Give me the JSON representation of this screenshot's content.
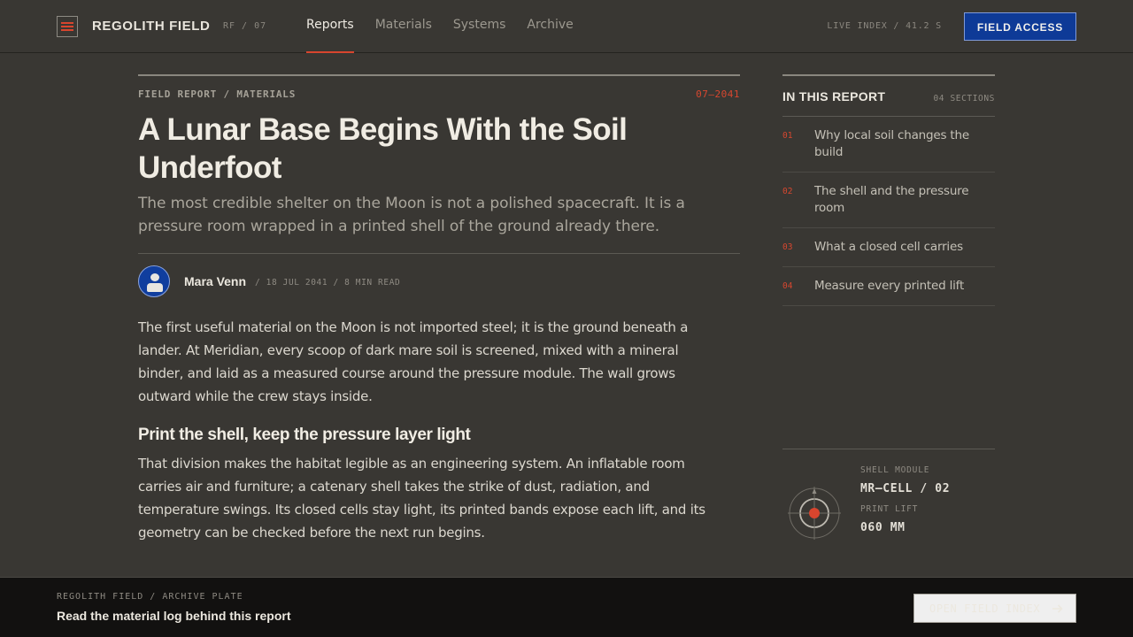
{
  "header": {
    "brand": "REGOLITH FIELD",
    "brand_code": "RF / 07",
    "nav": [
      {
        "label": "Reports",
        "active": true
      },
      {
        "label": "Materials"
      },
      {
        "label": "Systems"
      },
      {
        "label": "Archive"
      }
    ],
    "live_index": "LIVE INDEX / 41.2 S",
    "field_access_label": "FIELD ACCESS",
    "accent_color": "#d8452e",
    "cta_color": "#0e3a97"
  },
  "article": {
    "kicker": "FIELD REPORT / MATERIALS",
    "issue": "07—2041",
    "title": "A Lunar Base Begins With the Soil Underfoot",
    "dek": "The most credible shelter on the Moon is not a polished spacecraft. It is a pressure room wrapped in a printed shell of the ground already there.",
    "author": "Mara Venn",
    "meta": "/ 18 JUL 2041 / 8 MIN READ",
    "paragraph_1": "The first useful material on the Moon is not imported steel; it is the ground beneath a lander. At Meridian, every scoop of dark mare soil is screened, mixed with a mineral binder, and laid as a measured course around the pressure module. The wall grows outward while the crew stays inside.",
    "subhead": "Print the shell, keep the pressure layer light",
    "paragraph_2": "That division makes the habitat legible as an engineering system. An inflatable room carries air and furniture; a catenary shell takes the strike of dust, radiation, and temperature swings. Its closed cells stay light, its printed bands expose each lift, and its geometry can be checked before the next run begins."
  },
  "toc": {
    "title": "IN THIS REPORT",
    "count": "04 SECTIONS",
    "items": [
      {
        "num": "01",
        "label": "Why local soil changes the build"
      },
      {
        "num": "02",
        "label": "The shell and the pressure room"
      },
      {
        "num": "03",
        "label": "What a closed cell carries"
      },
      {
        "num": "04",
        "label": "Measure every printed lift"
      }
    ]
  },
  "module": {
    "label_1": "SHELL MODULE",
    "value_1": "MR—CELL / 02",
    "label_2": "PRINT LIFT",
    "value_2": "060 MM",
    "icon": "target-gauge-icon"
  },
  "footer": {
    "eyebrow": "REGOLITH FIELD / ARCHIVE PLATE",
    "title": "Read the material log behind this report",
    "button_label": "OPEN FIELD INDEX",
    "button_icon": "arrow-right-icon"
  }
}
